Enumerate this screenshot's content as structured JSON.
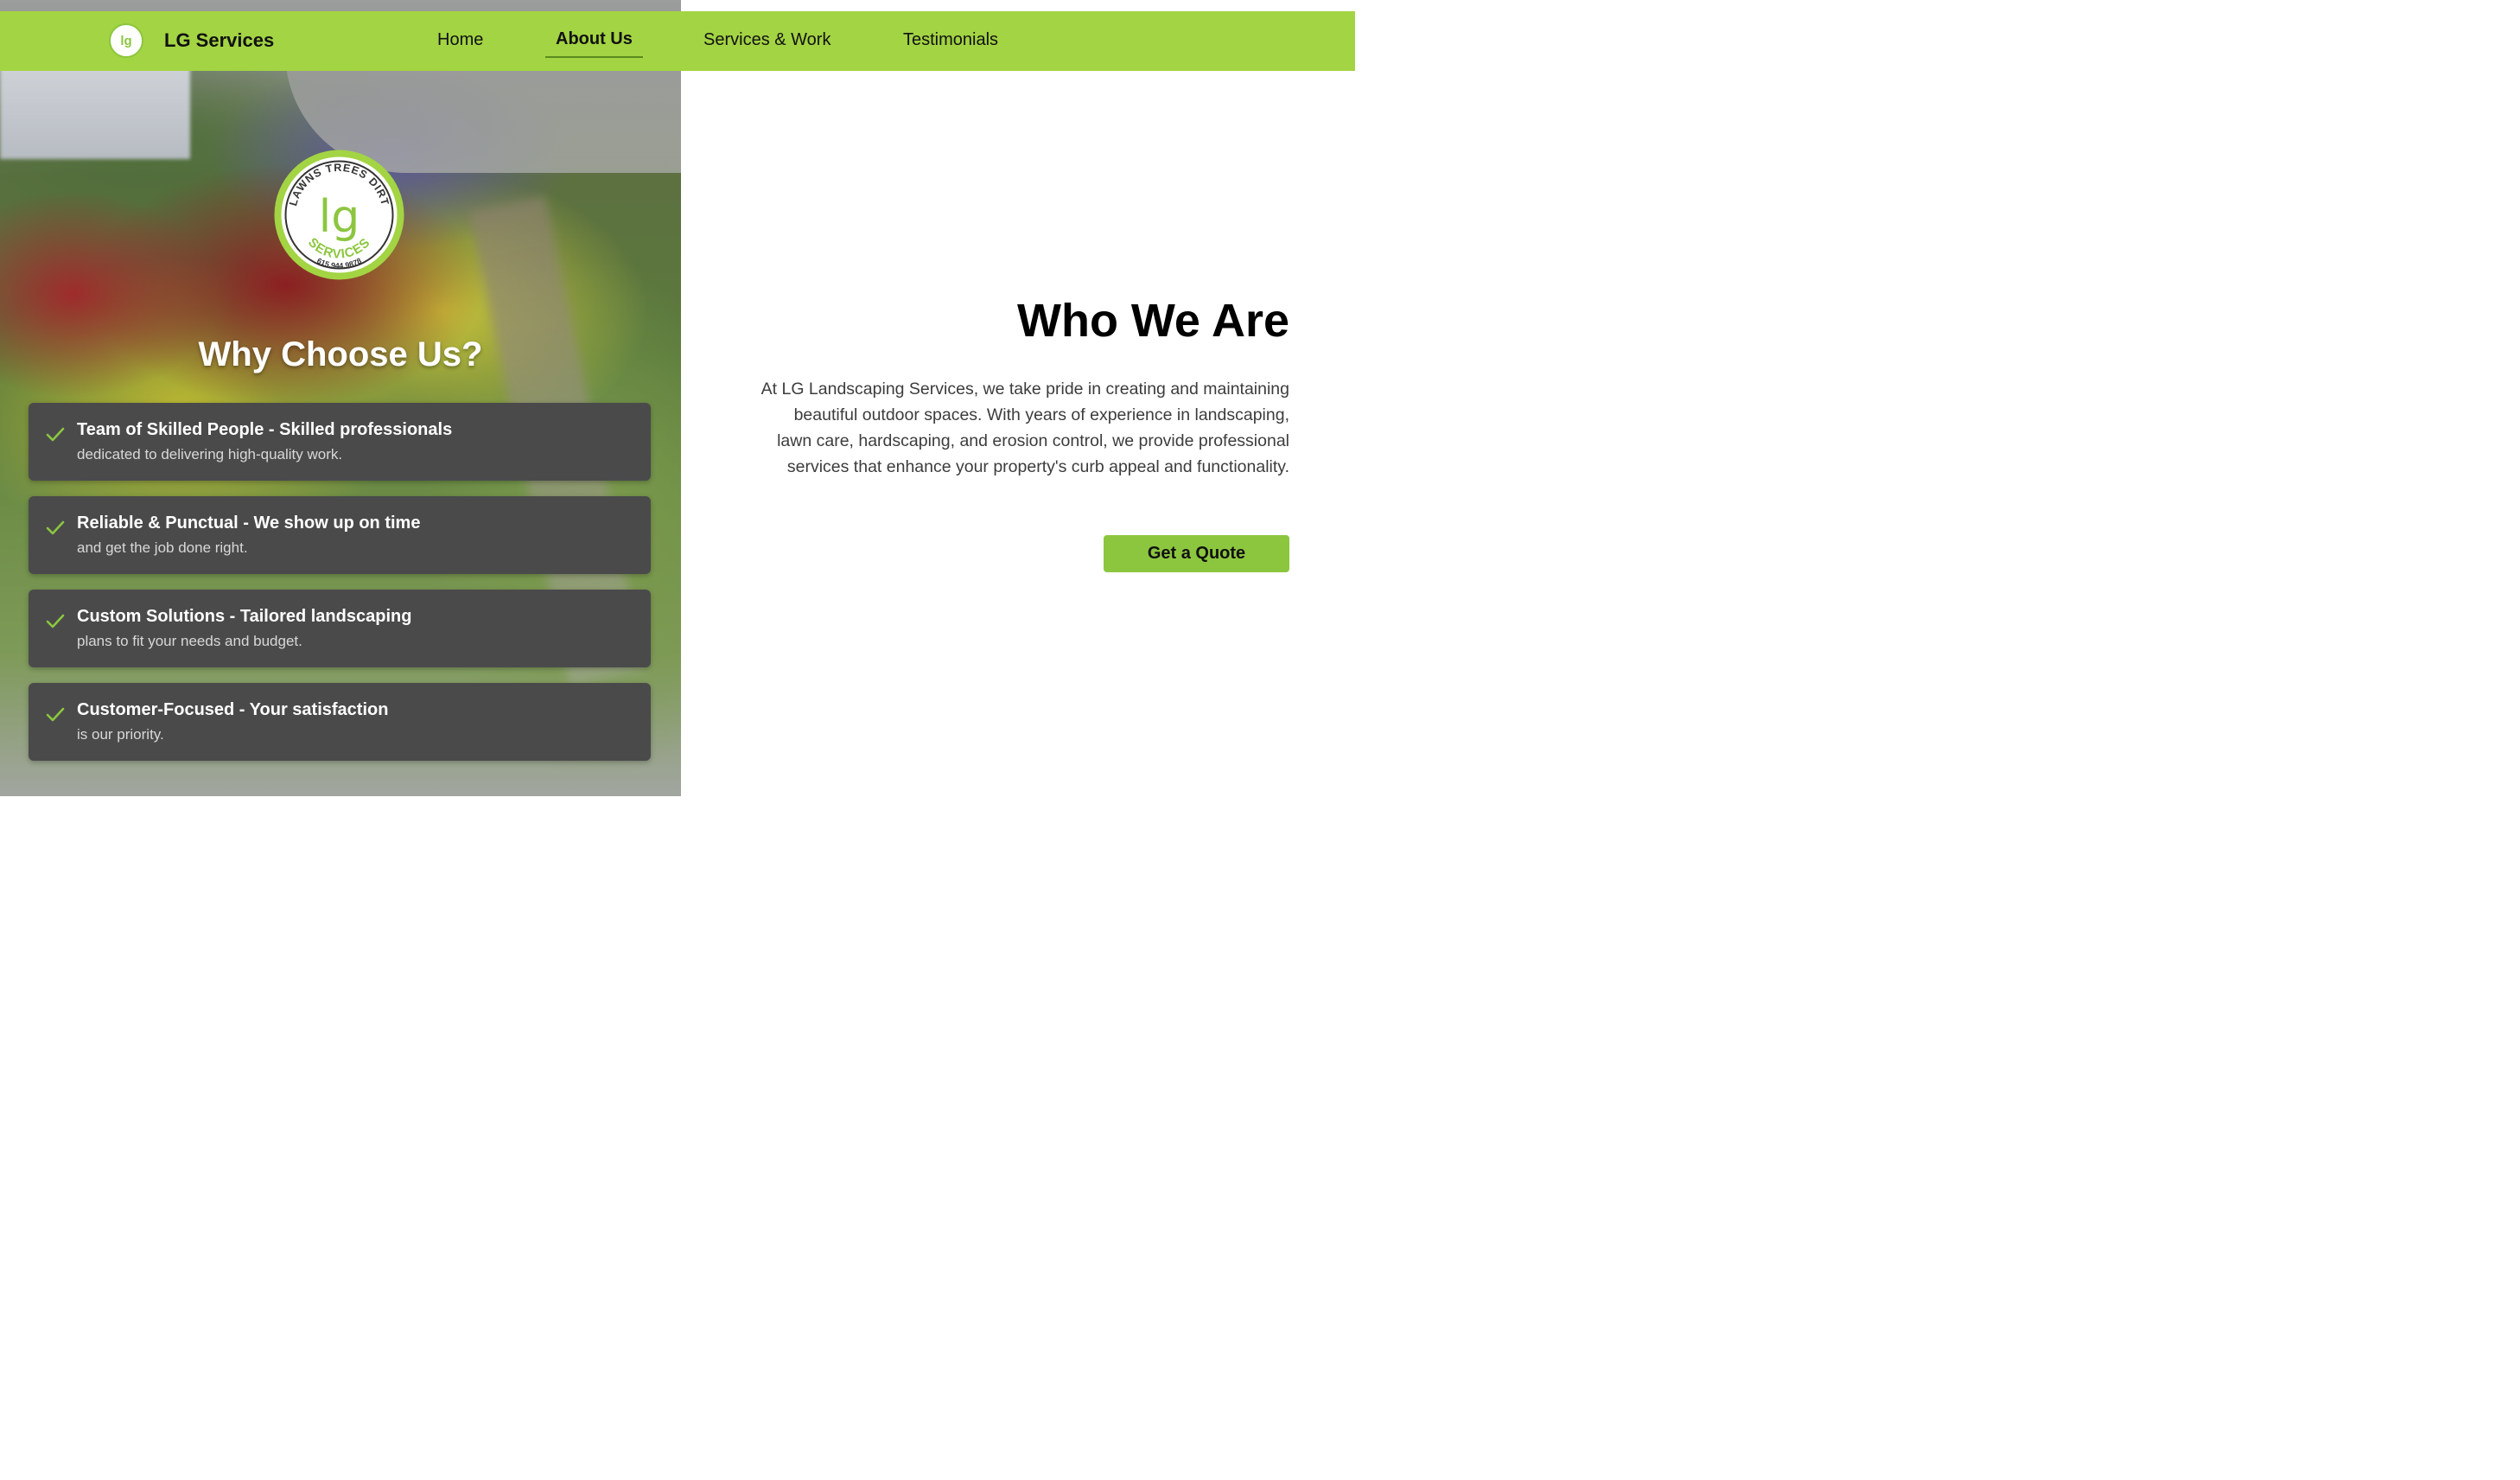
{
  "nav": {
    "brand_name": "LG Services",
    "brand_logo_text": "lg",
    "links": [
      {
        "label": "Home"
      },
      {
        "label": "About Us",
        "active": true
      },
      {
        "label": "Services & Work"
      },
      {
        "label": "Testimonials"
      }
    ]
  },
  "logo": {
    "top_text": "LAWNS TREES DIRT",
    "center_text": "lg",
    "bottom_text": "SERVICES",
    "phone": "615.944.9878"
  },
  "why": {
    "title": "Why Choose Us?",
    "items": [
      {
        "title": "Team of Skilled People - Skilled professionals",
        "desc": "dedicated to delivering high-quality work."
      },
      {
        "title": "Reliable & Punctual - We show up on time",
        "desc": "and get the job done right."
      },
      {
        "title": "Custom Solutions - Tailored landscaping",
        "desc": "plans to fit your needs and budget."
      },
      {
        "title": "Customer-Focused - Your satisfaction",
        "desc": "is our priority."
      }
    ]
  },
  "who": {
    "title": "Who We Are",
    "text": "At LG Landscaping Services, we take pride in creating and maintaining beautiful outdoor spaces. With years of experience in landscaping, lawn care, hardscaping, and erosion control, we provide professional services that enhance your property's curb appeal and functionality.",
    "cta_label": "Get a Quote"
  },
  "colors": {
    "nav_bg": "#a3d443",
    "accent": "#8cc63f",
    "card_bg": "#4a4a4b"
  },
  "icons": {
    "check": "check-icon"
  }
}
